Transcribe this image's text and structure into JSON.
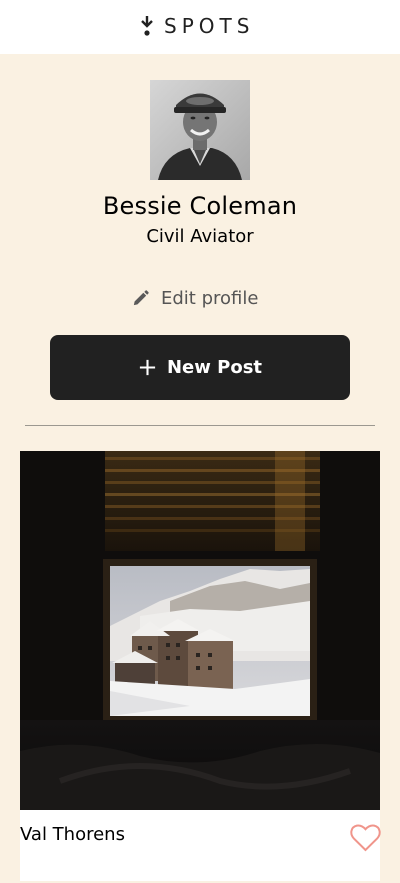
{
  "header": {
    "logo_text": "SPOTS"
  },
  "profile": {
    "name": "Bessie Coleman",
    "description": "Civil Aviator",
    "edit_label": "Edit profile",
    "new_post_label": "New Post"
  },
  "cards": [
    {
      "title": "Val Thorens",
      "liked": false
    }
  ],
  "colors": {
    "page_background": "#faf1e2",
    "header_background": "#ffffff",
    "button_background": "#212121",
    "like_outline": "#f0958b",
    "divider": "#9b9890"
  },
  "icons": {
    "logo": "spots-logo-icon",
    "edit": "pencil-icon",
    "new_post": "plus-icon",
    "like": "heart-outline-icon"
  }
}
